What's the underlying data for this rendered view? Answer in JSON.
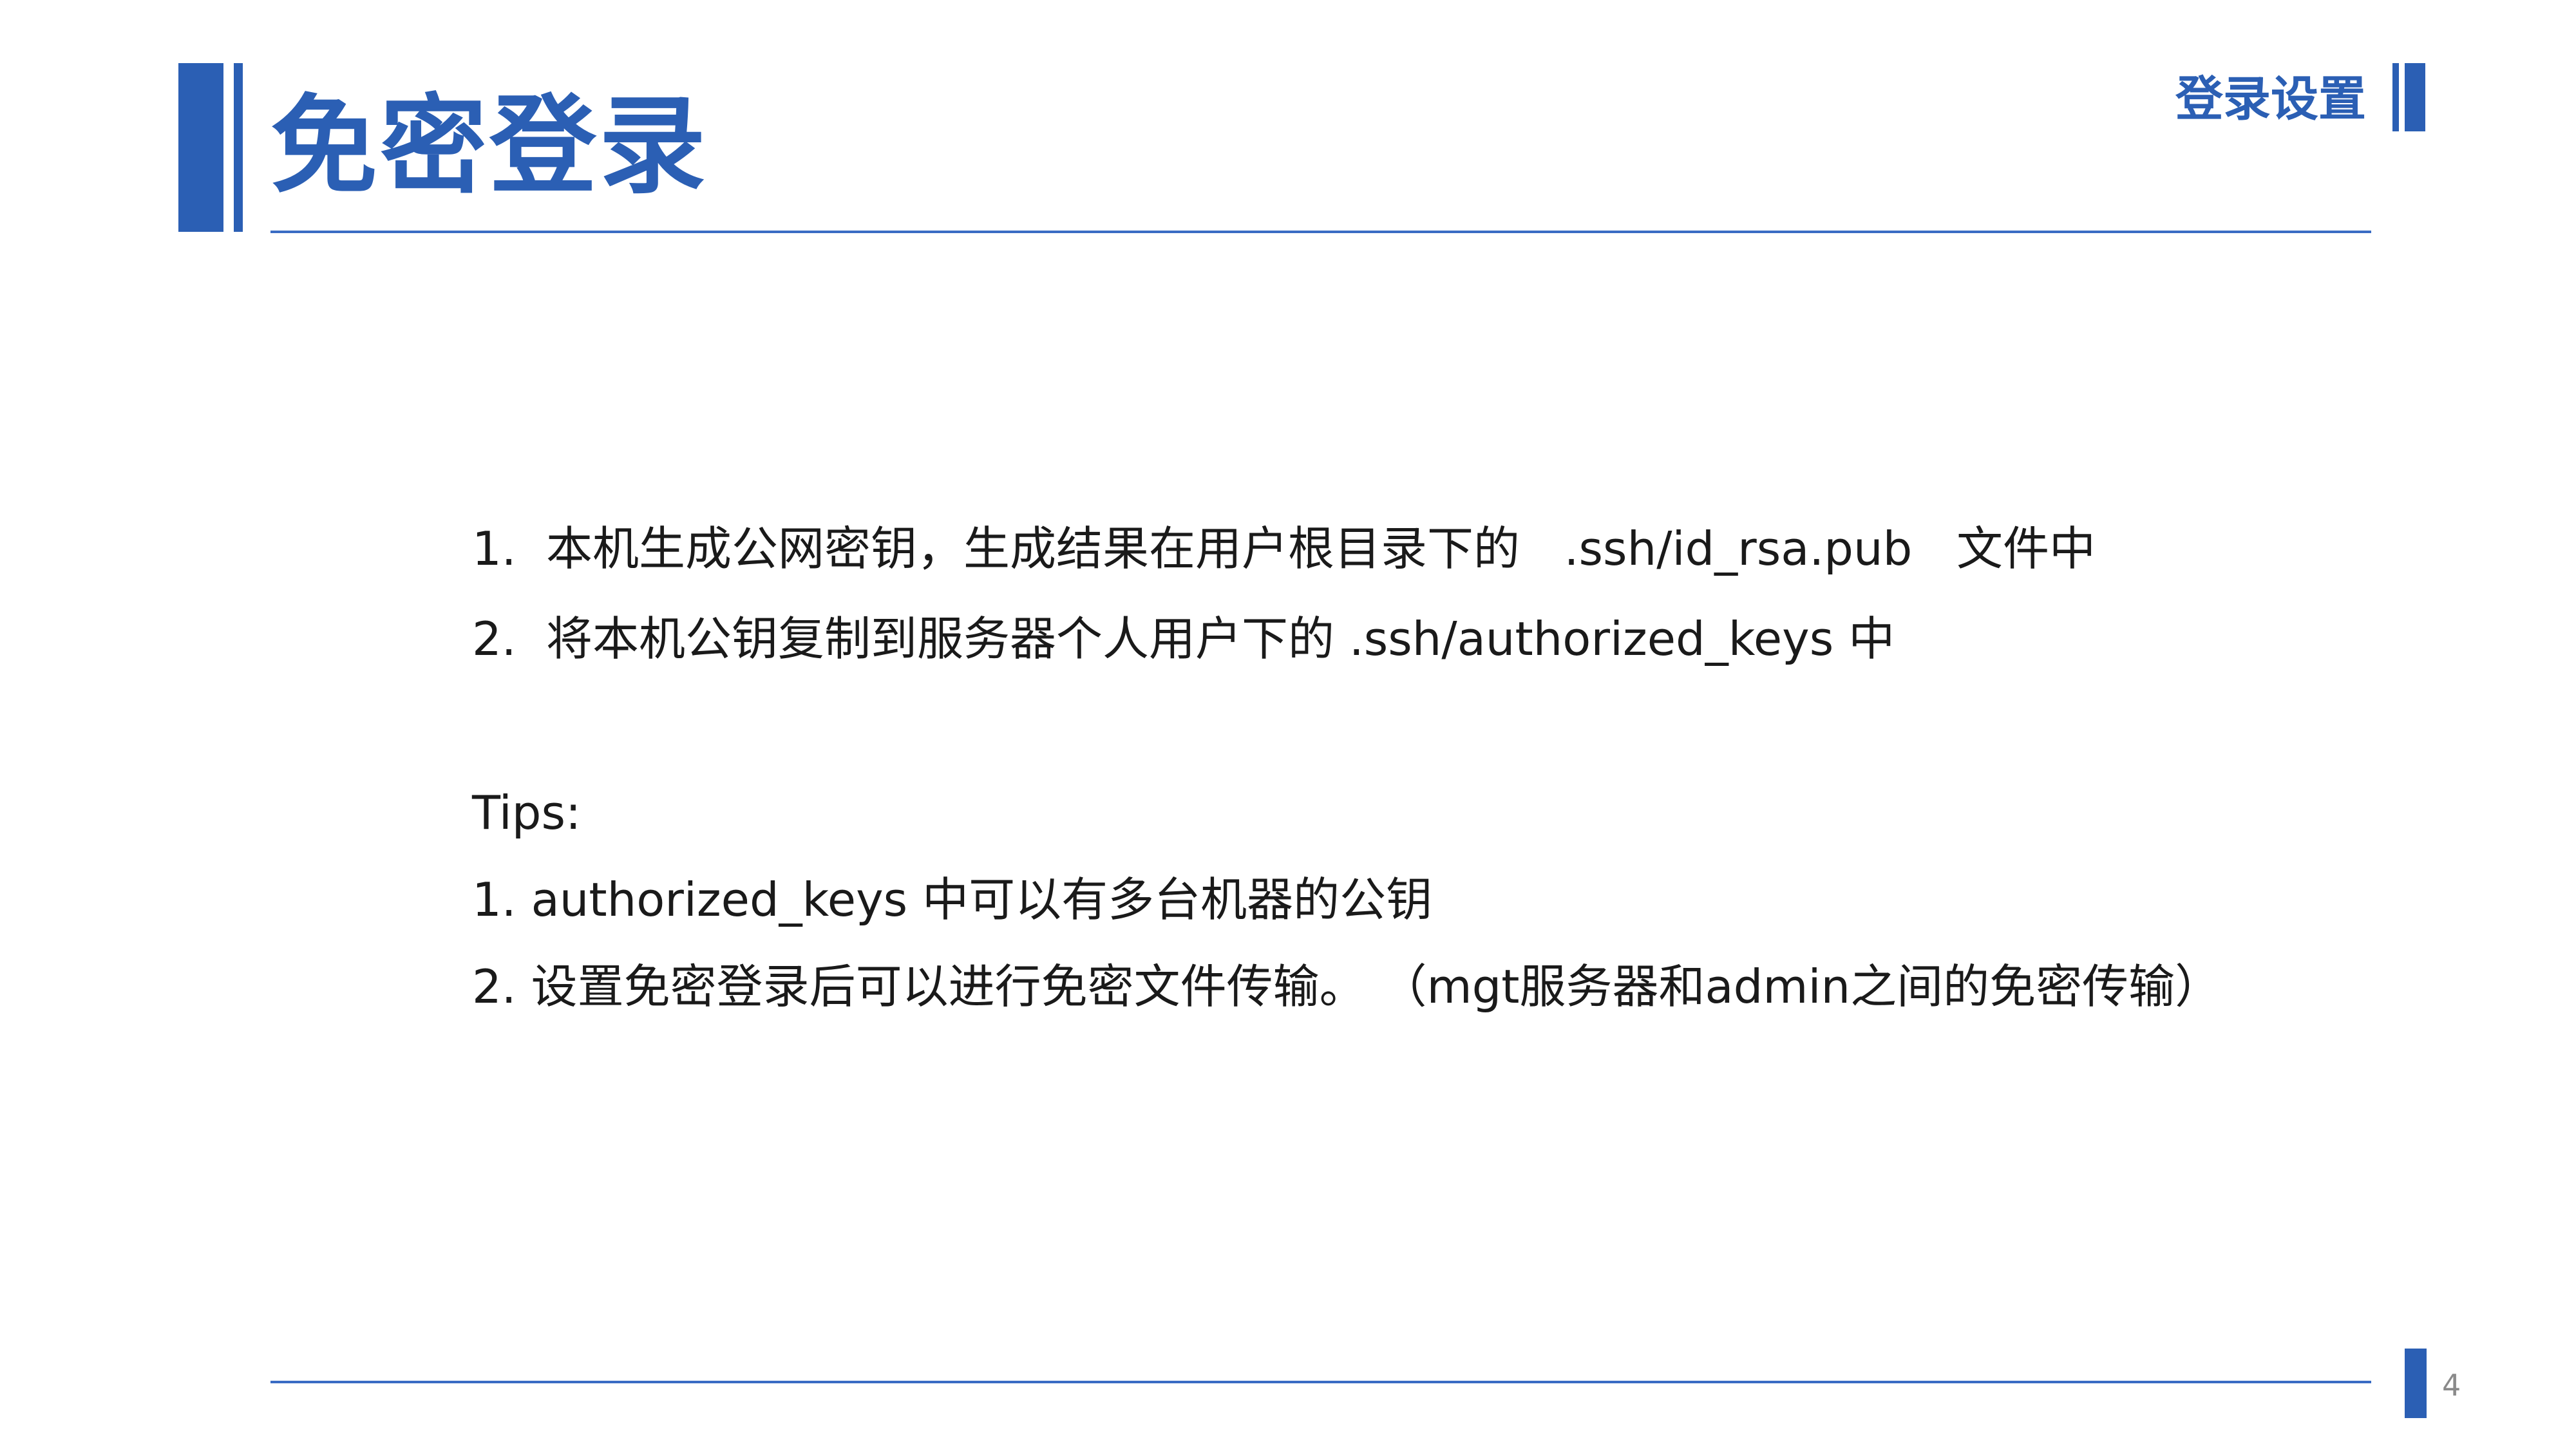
{
  "slide": {
    "title": "免密登录",
    "section_label": "登录设置",
    "page_number": "4",
    "accent_color": "#2b5fb4"
  },
  "steps": [
    {
      "number": "1.",
      "text": "本机生成公网密钥，生成结果在用户根目录下的   .ssh/id_rsa.pub   文件中"
    },
    {
      "number": "2.",
      "text": "将本机公钥复制到服务器个人用户下的 .ssh/authorized_keys 中"
    }
  ],
  "tips": {
    "heading": "Tips:",
    "items": [
      "1. authorized_keys 中可以有多台机器的公钥",
      "2. 设置免密登录后可以进行免密文件传输。 （mgt服务器和admin之间的免密传输）"
    ]
  }
}
